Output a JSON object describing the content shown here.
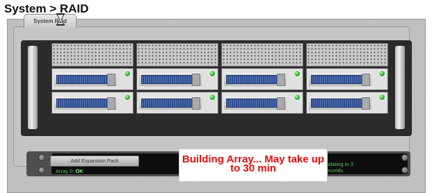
{
  "page": {
    "title": "System > RAID"
  },
  "tabs": [
    {
      "label": "System Raid"
    }
  ],
  "raid_panel": {
    "bays": [
      {
        "status": "ok"
      },
      {
        "status": "ok"
      },
      {
        "status": "ok"
      },
      {
        "status": "ok"
      },
      {
        "status": "ok"
      },
      {
        "status": "ok"
      },
      {
        "status": "ok"
      },
      {
        "status": "ok"
      }
    ],
    "led_color": "#2fa32f",
    "drive_plate_color": "#2f4e93"
  },
  "status_bar": {
    "add_expansion_label": "Add Expansion Pack",
    "array_label": "Array 0:",
    "array_state": "OK",
    "updating_text": "pdating in 3",
    "updating_text_2": "econds."
  },
  "overlay": {
    "line1": "Building Array... May take up",
    "line2": "to 30 min",
    "color": "#ea0b0b"
  },
  "icons": [
    "hourglass-icon",
    "screw-icon",
    "status-led-icon"
  ]
}
